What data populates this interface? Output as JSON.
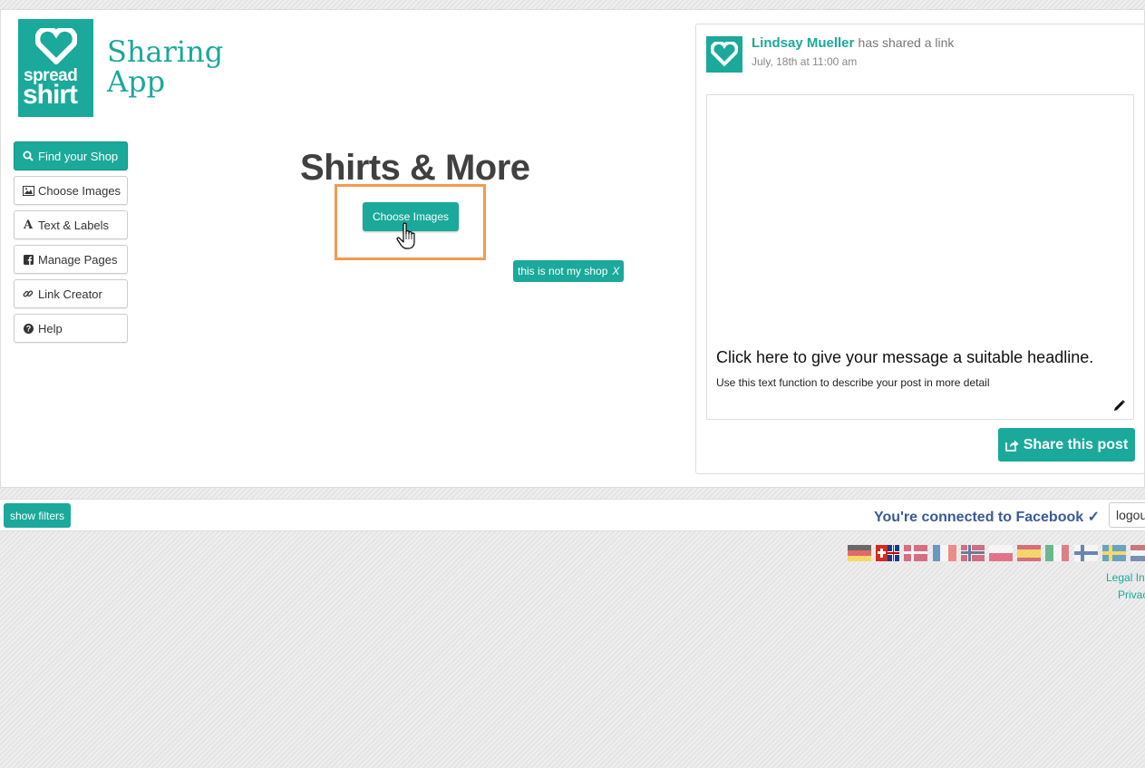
{
  "brand": {
    "logo_line1": "spread",
    "logo_line2": "shirt",
    "app_title_line1": "Sharing",
    "app_title_line2": "App"
  },
  "nav": {
    "items": [
      {
        "label": "Find your Shop",
        "icon": "search-icon",
        "active": true
      },
      {
        "label": "Choose Images",
        "icon": "image-icon",
        "active": false
      },
      {
        "label": "Text & Labels",
        "icon": "font-icon",
        "active": false
      },
      {
        "label": "Manage Pages",
        "icon": "facebook-icon",
        "active": false
      },
      {
        "label": "Link Creator",
        "icon": "link-icon",
        "active": false
      },
      {
        "label": "Help",
        "icon": "question-icon",
        "active": false
      }
    ]
  },
  "main": {
    "shop_title": "Shirts & More",
    "choose_button": "Choose Images",
    "not_my_shop": "this is not my shop",
    "not_my_shop_close": "X"
  },
  "preview": {
    "user_name": "Lindsay Mueller",
    "action": "has shared a link",
    "date": "July, 18th at 11:00 am",
    "headline": "Click here to give your message a suitable headline.",
    "description": "Use this text function to describe your post in more detail",
    "share_button": "Share this post"
  },
  "bar": {
    "filters_button": "show filters",
    "fb_status": "You're connected to Facebook ✓",
    "logout": "logout"
  },
  "footer": {
    "languages": [
      "de",
      "ch",
      "dk",
      "fr",
      "no",
      "pl",
      "es",
      "it",
      "fi",
      "se",
      "nl"
    ],
    "legal": "Legal In",
    "privacy": "Privac"
  },
  "colors": {
    "accent": "#1aa99a",
    "highlight": "#f39a4f",
    "facebook": "#3b5998"
  }
}
